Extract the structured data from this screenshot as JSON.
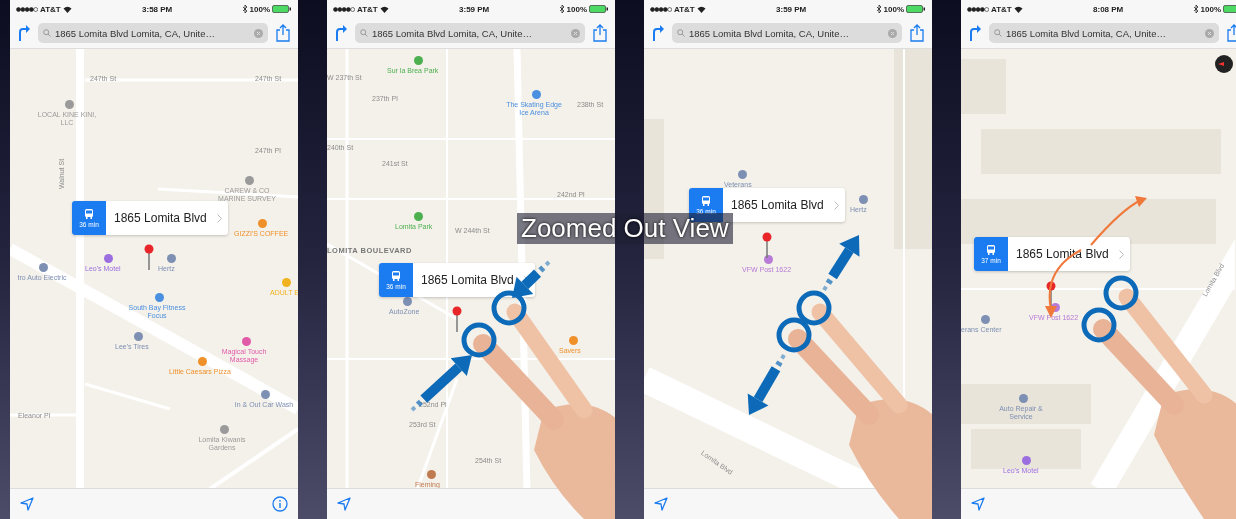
{
  "caption": "Zoomed Out View",
  "phones": [
    {
      "status": {
        "carrier": "AT&T",
        "time": "3:58 PM",
        "battery": "100%"
      },
      "search": "1865 Lomita Blvd Lomita, CA, Unite…",
      "callout": {
        "title": "1865 Lomita Blvd",
        "eta": "36 min"
      },
      "kind": "plain",
      "info_button": true,
      "compass": false,
      "labels": [
        {
          "text": "247th St",
          "kind": "street"
        },
        {
          "text": "247th St",
          "kind": "street"
        },
        {
          "text": "LOCAL KINE KINI, LLC",
          "kind": "poi",
          "color": "#9a9a9a"
        },
        {
          "text": "247th Pl",
          "kind": "street"
        },
        {
          "text": "CAREW & CO MARINE SURVEY",
          "kind": "poi",
          "color": "#9a9a9a"
        },
        {
          "text": "GIZZI'S COFFEE",
          "kind": "poi",
          "color": "#f0902a"
        },
        {
          "text": "Leo's Motel",
          "kind": "poi",
          "color": "#9b6ee0"
        },
        {
          "text": "Hertz",
          "kind": "poi",
          "color": "#7d8fb3"
        },
        {
          "text": "ADULT E",
          "kind": "poi",
          "color": "#f0b21e"
        },
        {
          "text": "tro Auto Electric",
          "kind": "poi",
          "color": "#7d8fb3"
        },
        {
          "text": "South Bay Fitness Focus",
          "kind": "poi",
          "color": "#4a8fe0"
        },
        {
          "text": "Lee's Tires",
          "kind": "poi",
          "color": "#7d8fb3"
        },
        {
          "text": "Magical Touch Massage",
          "kind": "poi",
          "color": "#e05aa8"
        },
        {
          "text": "Little Caesars Pizza",
          "kind": "poi",
          "color": "#f0902a"
        },
        {
          "text": "In & Out Car Wash",
          "kind": "poi",
          "color": "#7d8fb3"
        },
        {
          "text": "Eleanor Pl",
          "kind": "street"
        },
        {
          "text": "Lomita Kiwanis Gardens",
          "kind": "poi",
          "color": "#9a9a9a"
        },
        {
          "text": "Walnut St",
          "kind": "vstreet"
        }
      ]
    },
    {
      "status": {
        "carrier": "AT&T",
        "time": "3:59 PM",
        "battery": "100%"
      },
      "search": "1865 Lomita Blvd Lomita, CA, Unite…",
      "callout": {
        "title": "1865 Lomita Blvd",
        "eta": "36 min"
      },
      "kind": "pinch-in",
      "info_button": false,
      "compass": false,
      "labels": [
        {
          "text": "Sur la Brea Park",
          "kind": "poi",
          "color": "#4caf50"
        },
        {
          "text": "W 237th St",
          "kind": "street"
        },
        {
          "text": "237th Pl",
          "kind": "street"
        },
        {
          "text": "The Skating Edge Ice Arena",
          "kind": "poi",
          "color": "#4a8fe0"
        },
        {
          "text": "238th St",
          "kind": "street"
        },
        {
          "text": "240th St",
          "kind": "street"
        },
        {
          "text": "241st St",
          "kind": "street"
        },
        {
          "text": "242nd Pl",
          "kind": "street"
        },
        {
          "text": "Lomita Park",
          "kind": "poi",
          "color": "#4caf50"
        },
        {
          "text": "W 244th St",
          "kind": "street"
        },
        {
          "text": "LOMITA BOULEVARD",
          "kind": "area"
        },
        {
          "text": "AutoZone",
          "kind": "poi",
          "color": "#7d8fb3"
        },
        {
          "text": "Savers",
          "kind": "poi",
          "color": "#f0902a"
        },
        {
          "text": "252nd Pl",
          "kind": "street"
        },
        {
          "text": "253rd St",
          "kind": "street"
        },
        {
          "text": "254th St",
          "kind": "street"
        },
        {
          "text": "Fleming",
          "kind": "poi",
          "color": "#c07a50"
        }
      ]
    },
    {
      "status": {
        "carrier": "AT&T",
        "time": "3:59 PM",
        "battery": "100%"
      },
      "search": "1865 Lomita Blvd Lomita, CA, Unite…",
      "callout": {
        "title": "1865 Lomita Blvd",
        "eta": "36 min"
      },
      "kind": "pinch-out",
      "info_button": false,
      "compass": false,
      "labels": [
        {
          "text": "Veterans",
          "kind": "poi",
          "color": "#7d8fb3"
        },
        {
          "text": "Hertz",
          "kind": "poi",
          "color": "#7d8fb3"
        },
        {
          "text": "VFW Post 1622",
          "kind": "poi",
          "color": "#b77ad6"
        },
        {
          "text": "Lomita Blvd",
          "kind": "road"
        }
      ]
    },
    {
      "status": {
        "carrier": "AT&T",
        "time": "8:08 PM",
        "battery": "100%"
      },
      "search": "1865 Lomita Blvd Lomita, CA, Unite…",
      "callout": {
        "title": "1865 Lomita Blvd",
        "eta": "37 min"
      },
      "kind": "rotate",
      "info_button": false,
      "compass": true,
      "labels": [
        {
          "text": "VFW Post 1622",
          "kind": "poi",
          "color": "#b77ad6"
        },
        {
          "text": "erans Center",
          "kind": "poi",
          "color": "#7d8fb3"
        },
        {
          "text": "Auto Repair & Service",
          "kind": "poi",
          "color": "#7d8fb3"
        },
        {
          "text": "Leo's Motel",
          "kind": "poi",
          "color": "#9b6ee0"
        },
        {
          "text": "Lomita Blvd",
          "kind": "road"
        }
      ]
    }
  ]
}
